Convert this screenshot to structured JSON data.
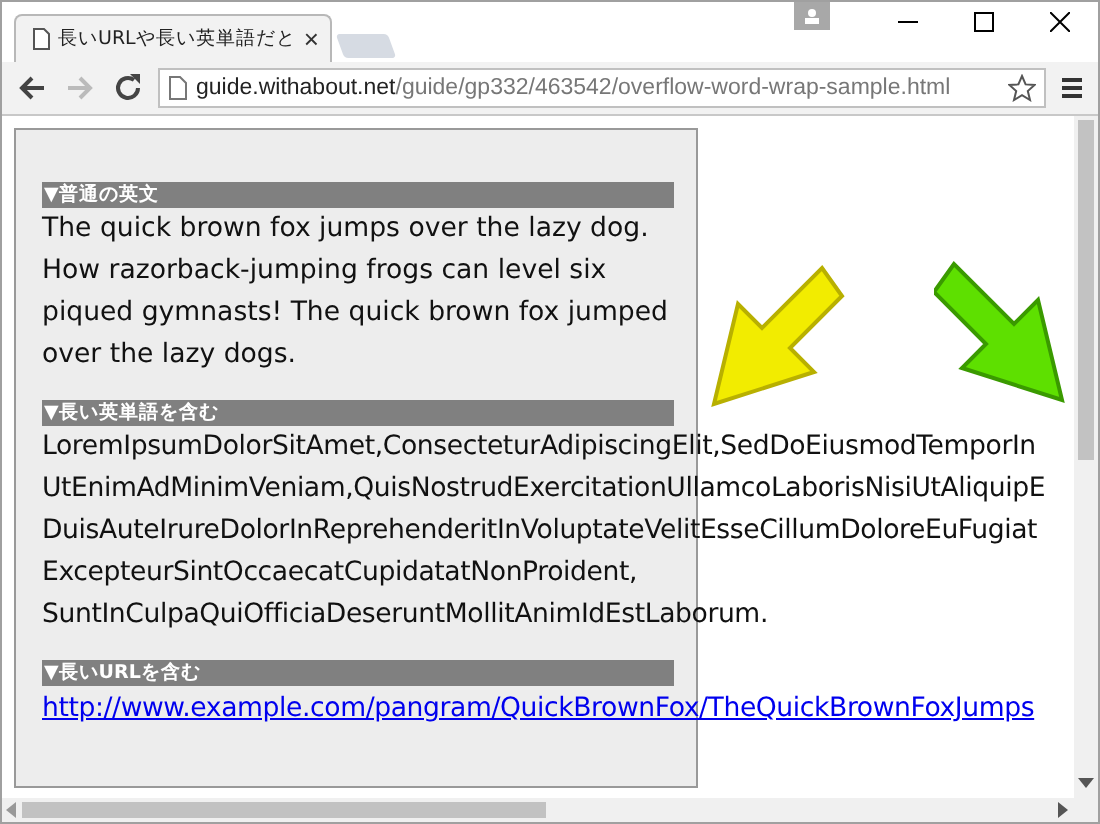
{
  "window": {
    "tab": {
      "title": "長いURLや長い英単語だと",
      "close": "×"
    },
    "address": {
      "host": "guide.withabout.net",
      "path": "/guide/gp332/463542/overflow-word-wrap-sample.html"
    }
  },
  "sections": [
    {
      "heading": "▼普通の英文",
      "kind": "text",
      "text": "The quick brown fox jumps over the lazy dog. How razorback-jumping frogs can level six piqued gymnasts! The quick brown fox jumped over the lazy dogs."
    },
    {
      "heading": "▼長い英単語を含む",
      "kind": "lines",
      "lines": [
        "LoremIpsumDolorSitAmet,ConsecteturAdipiscingElit,SedDoEiusmodTemporIn",
        "UtEnimAdMinimVeniam,QuisNostrudExercitationUllamcoLaborisNisiUtAliquipE",
        "DuisAuteIrureDolorInReprehenderitInVoluptateVelitEsseCillumDoloreEuFugiat",
        "ExcepteurSintOccaecatCupidatatNonProident,",
        "SuntInCulpaQuiOfficiaDeseruntMollitAnimIdEstLaborum."
      ]
    },
    {
      "heading": "▼長いURLを含む",
      "kind": "link",
      "text": "http://www.example.com/pangram/QuickBrownFox/TheQuickBrownFoxJumps"
    }
  ]
}
